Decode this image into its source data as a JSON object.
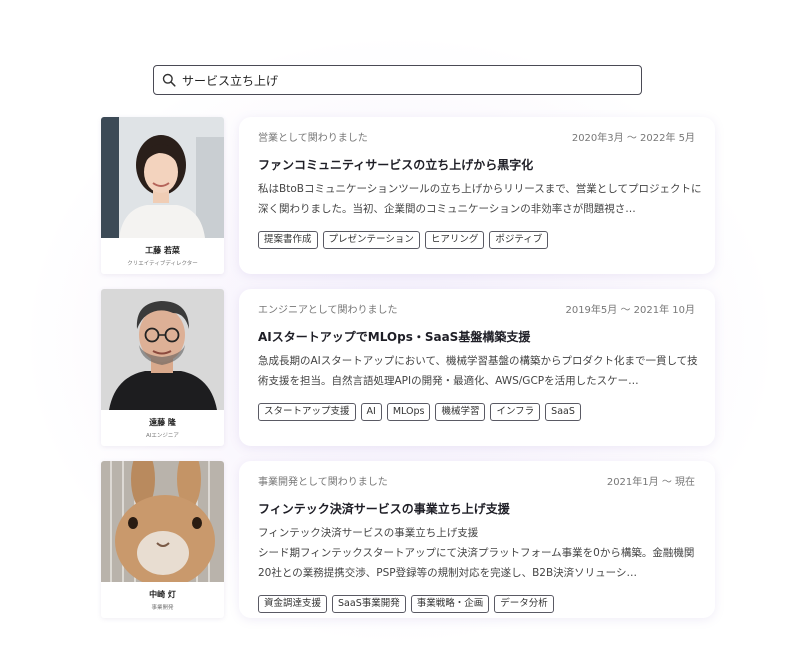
{
  "search": {
    "value": "サービス立ち上げ",
    "icon": "search-icon"
  },
  "entries": [
    {
      "person": {
        "name": "工藤 若菜",
        "role": "クリエイティブディレクター"
      },
      "relation": "営業として関わりました",
      "period": "2020年3月 〜 2022年 5月",
      "title": "ファンコミュニティサービスの立ち上げから黒字化",
      "description": "私はBtoBコミュニケーションツールの立ち上げからリリースまで、営業としてプロジェクトに深く関わりました。当初、企業間のコミュニケーションの非効率さが問題視さ…",
      "tags": [
        "提案書作成",
        "プレゼンテーション",
        "ヒアリング",
        "ポジティブ"
      ]
    },
    {
      "person": {
        "name": "遠藤 隆",
        "role": "AIエンジニア"
      },
      "relation": "エンジニアとして関わりました",
      "period": "2019年5月 〜 2021年 10月",
      "title": "AIスタートアップでMLOps・SaaS基盤構築支援",
      "description": "急成長期のAIスタートアップにおいて、機械学習基盤の構築からプロダクト化まで一貫して技術支援を担当。自然言語処理APIの開発・最適化、AWS/GCPを活用したスケー…",
      "tags": [
        "スタートアップ支援",
        "AI",
        "MLOps",
        "機械学習",
        "インフラ",
        "SaaS"
      ]
    },
    {
      "person": {
        "name": "中崎 灯",
        "role": "事業開発"
      },
      "relation": "事業開発として関わりました",
      "period": "2021年1月 〜 現在",
      "title": "フィンテック決済サービスの事業立ち上げ支援",
      "description": "フィンテック決済サービスの事業立ち上げ支援\nシード期フィンテックスタートアップにて決済プラットフォーム事業を0から構築。金融機関20社との業務提携交渉、PSP登録等の規制対応を完遂し、B2B決済ソリューシ…",
      "tags": [
        "資金調達支援",
        "SaaS事業開発",
        "事業戦略・企画",
        "データ分析"
      ]
    }
  ]
}
